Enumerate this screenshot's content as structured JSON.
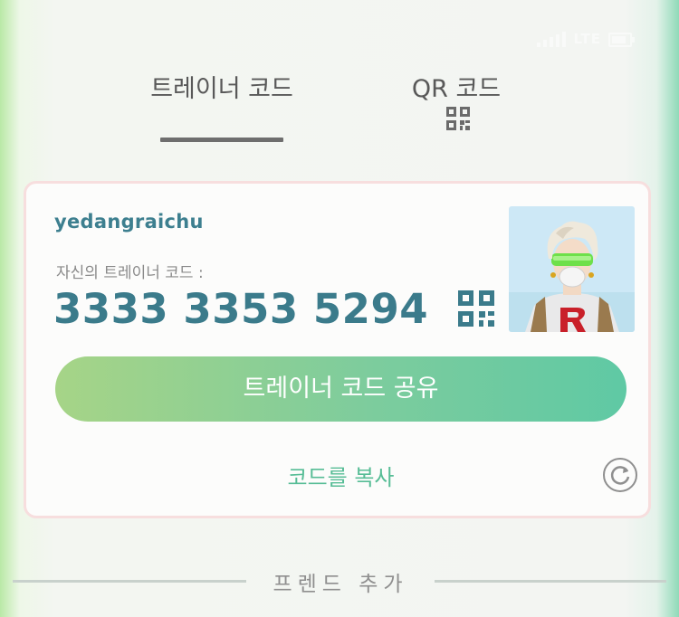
{
  "tabs": [
    {
      "label": "트레이너 코드",
      "active": true
    },
    {
      "label": "QR 코드",
      "active": false,
      "icon": "qr-code-icon"
    }
  ],
  "status_bar": {
    "network": "LTE"
  },
  "card": {
    "username": "yedangraichu",
    "code_label": "자신의 트레이너 코드 :",
    "trainer_code": "3333 3353 5294",
    "qr_icon": "qr-code-icon",
    "avatar": "trainer-avatar",
    "share_button_label": "트레이너 코드 공유",
    "copy_label": "코드를 복사",
    "refresh_icon": "refresh-icon"
  },
  "add_friend": {
    "title": "프렌드 추가"
  },
  "colors": {
    "accent_teal": "#3b7b8b",
    "button_gradient_start": "#a6d487",
    "button_gradient_end": "#5fc9a4",
    "copy_text": "#57bd96",
    "card_border": "#f7dede"
  }
}
